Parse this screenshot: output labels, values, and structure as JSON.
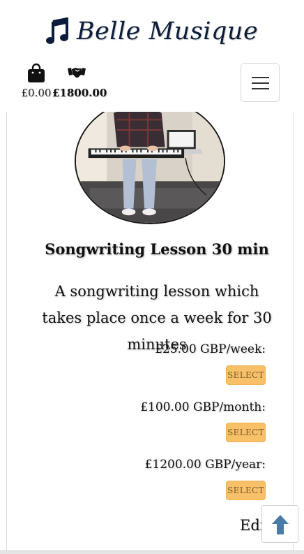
{
  "brand": {
    "name": "Belle Musique",
    "icon": "music-note-icon",
    "color": "#0b1d3a"
  },
  "header": {
    "bag_icon": "shopping-bag-icon",
    "bag_total": "£0.00",
    "deals_icon": "handshake-icon",
    "deals_total": "£1800.00",
    "menu_icon": "hamburger-icon"
  },
  "product": {
    "title": "Songwriting Lesson 30 min",
    "description": "A songwriting lesson which takes place once a week for 30 minutes",
    "image_subject": "person playing a keyboard on a bed beside a laptop",
    "plans": [
      {
        "price": "£25.00 GBP/week:",
        "button": "SELECT"
      },
      {
        "price": "£100.00 GBP/month:",
        "button": "SELECT"
      },
      {
        "price": "£1200.00 GBP/year:",
        "button": "SELECT"
      }
    ],
    "edit_label": "Edit"
  },
  "back_to_top": {
    "icon": "arrow-up-icon",
    "color": "#4a7ba6"
  },
  "colors": {
    "select_button": "#f9c06a",
    "select_text": "#7a5a22"
  }
}
